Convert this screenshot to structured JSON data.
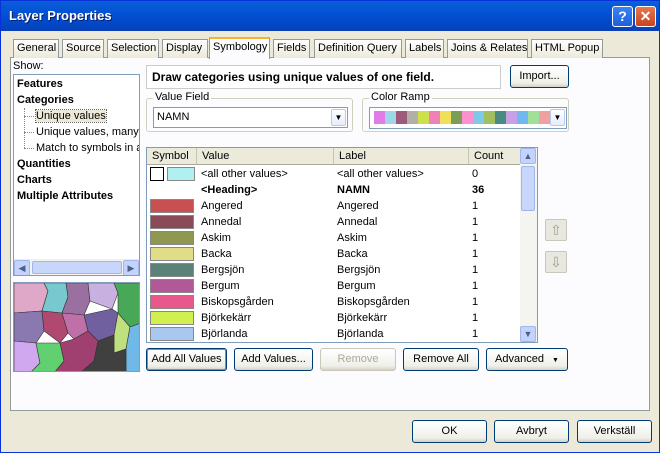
{
  "window": {
    "title": "Layer Properties"
  },
  "tabs": [
    "General",
    "Source",
    "Selection",
    "Display",
    "Symbology",
    "Fields",
    "Definition Query",
    "Labels",
    "Joins & Relates",
    "HTML Popup"
  ],
  "active_tab": "Symbology",
  "show": {
    "label": "Show:",
    "tree": [
      {
        "label": "Features"
      },
      {
        "label": "Categories"
      },
      {
        "label": "Unique values"
      },
      {
        "label": "Unique values, many f"
      },
      {
        "label": "Match to symbols in a"
      },
      {
        "label": "Quantities"
      },
      {
        "label": "Charts"
      },
      {
        "label": "Multiple Attributes"
      }
    ]
  },
  "description": "Draw categories using unique values of one field.",
  "import_button": "Import...",
  "value_field": {
    "legend": "Value Field",
    "value": "NAMN"
  },
  "color_ramp": {
    "legend": "Color Ramp",
    "colors": [
      "#e07be8",
      "#9ed8e6",
      "#9e5a7a",
      "#b0b0a8",
      "#cde04a",
      "#f080b8",
      "#f0e058",
      "#7a9e58",
      "#ff90d0",
      "#80c8e8",
      "#a0c060",
      "#4a8a80",
      "#c8a0e8",
      "#70b8f0",
      "#a0e098",
      "#f0a0a0"
    ]
  },
  "table": {
    "headers": {
      "symbol": "Symbol",
      "value": "Value",
      "label": "Label",
      "count": "Count"
    },
    "rows": [
      {
        "color": "#ffffff",
        "border": "#000000",
        "value": "<all other values>",
        "label": "<all other values>",
        "count": "0",
        "bold": false,
        "swatch2": "#b0f0f0"
      },
      {
        "color": "",
        "value": "<Heading>",
        "label": "NAMN",
        "count": "36",
        "bold": true
      },
      {
        "color": "#c85050",
        "value": "Angered",
        "label": "Angered",
        "count": "1",
        "bold": false
      },
      {
        "color": "#8a4a58",
        "value": "Annedal",
        "label": "Annedal",
        "count": "1",
        "bold": false
      },
      {
        "color": "#8e9850",
        "value": "Askim",
        "label": "Askim",
        "count": "1",
        "bold": false
      },
      {
        "color": "#e0dc88",
        "value": "Backa",
        "label": "Backa",
        "count": "1",
        "bold": false
      },
      {
        "color": "#5a8278",
        "value": "Bergsjön",
        "label": "Bergsjön",
        "count": "1",
        "bold": false
      },
      {
        "color": "#b05898",
        "value": "Bergum",
        "label": "Bergum",
        "count": "1",
        "bold": false
      },
      {
        "color": "#e8588a",
        "value": "Biskopsgården",
        "label": "Biskopsgården",
        "count": "1",
        "bold": false
      },
      {
        "color": "#d0f050",
        "value": "Björkekärr",
        "label": "Björkekärr",
        "count": "1",
        "bold": false
      },
      {
        "color": "#a8c8f0",
        "value": "Björlanda",
        "label": "Björlanda",
        "count": "1",
        "bold": false
      }
    ]
  },
  "buttons": {
    "add_all": "Add All Values",
    "add_values": "Add Values...",
    "remove": "Remove",
    "remove_all": "Remove All",
    "advanced": "Advanced"
  },
  "footer": {
    "ok": "OK",
    "cancel": "Avbryt",
    "apply": "Verkställ"
  }
}
